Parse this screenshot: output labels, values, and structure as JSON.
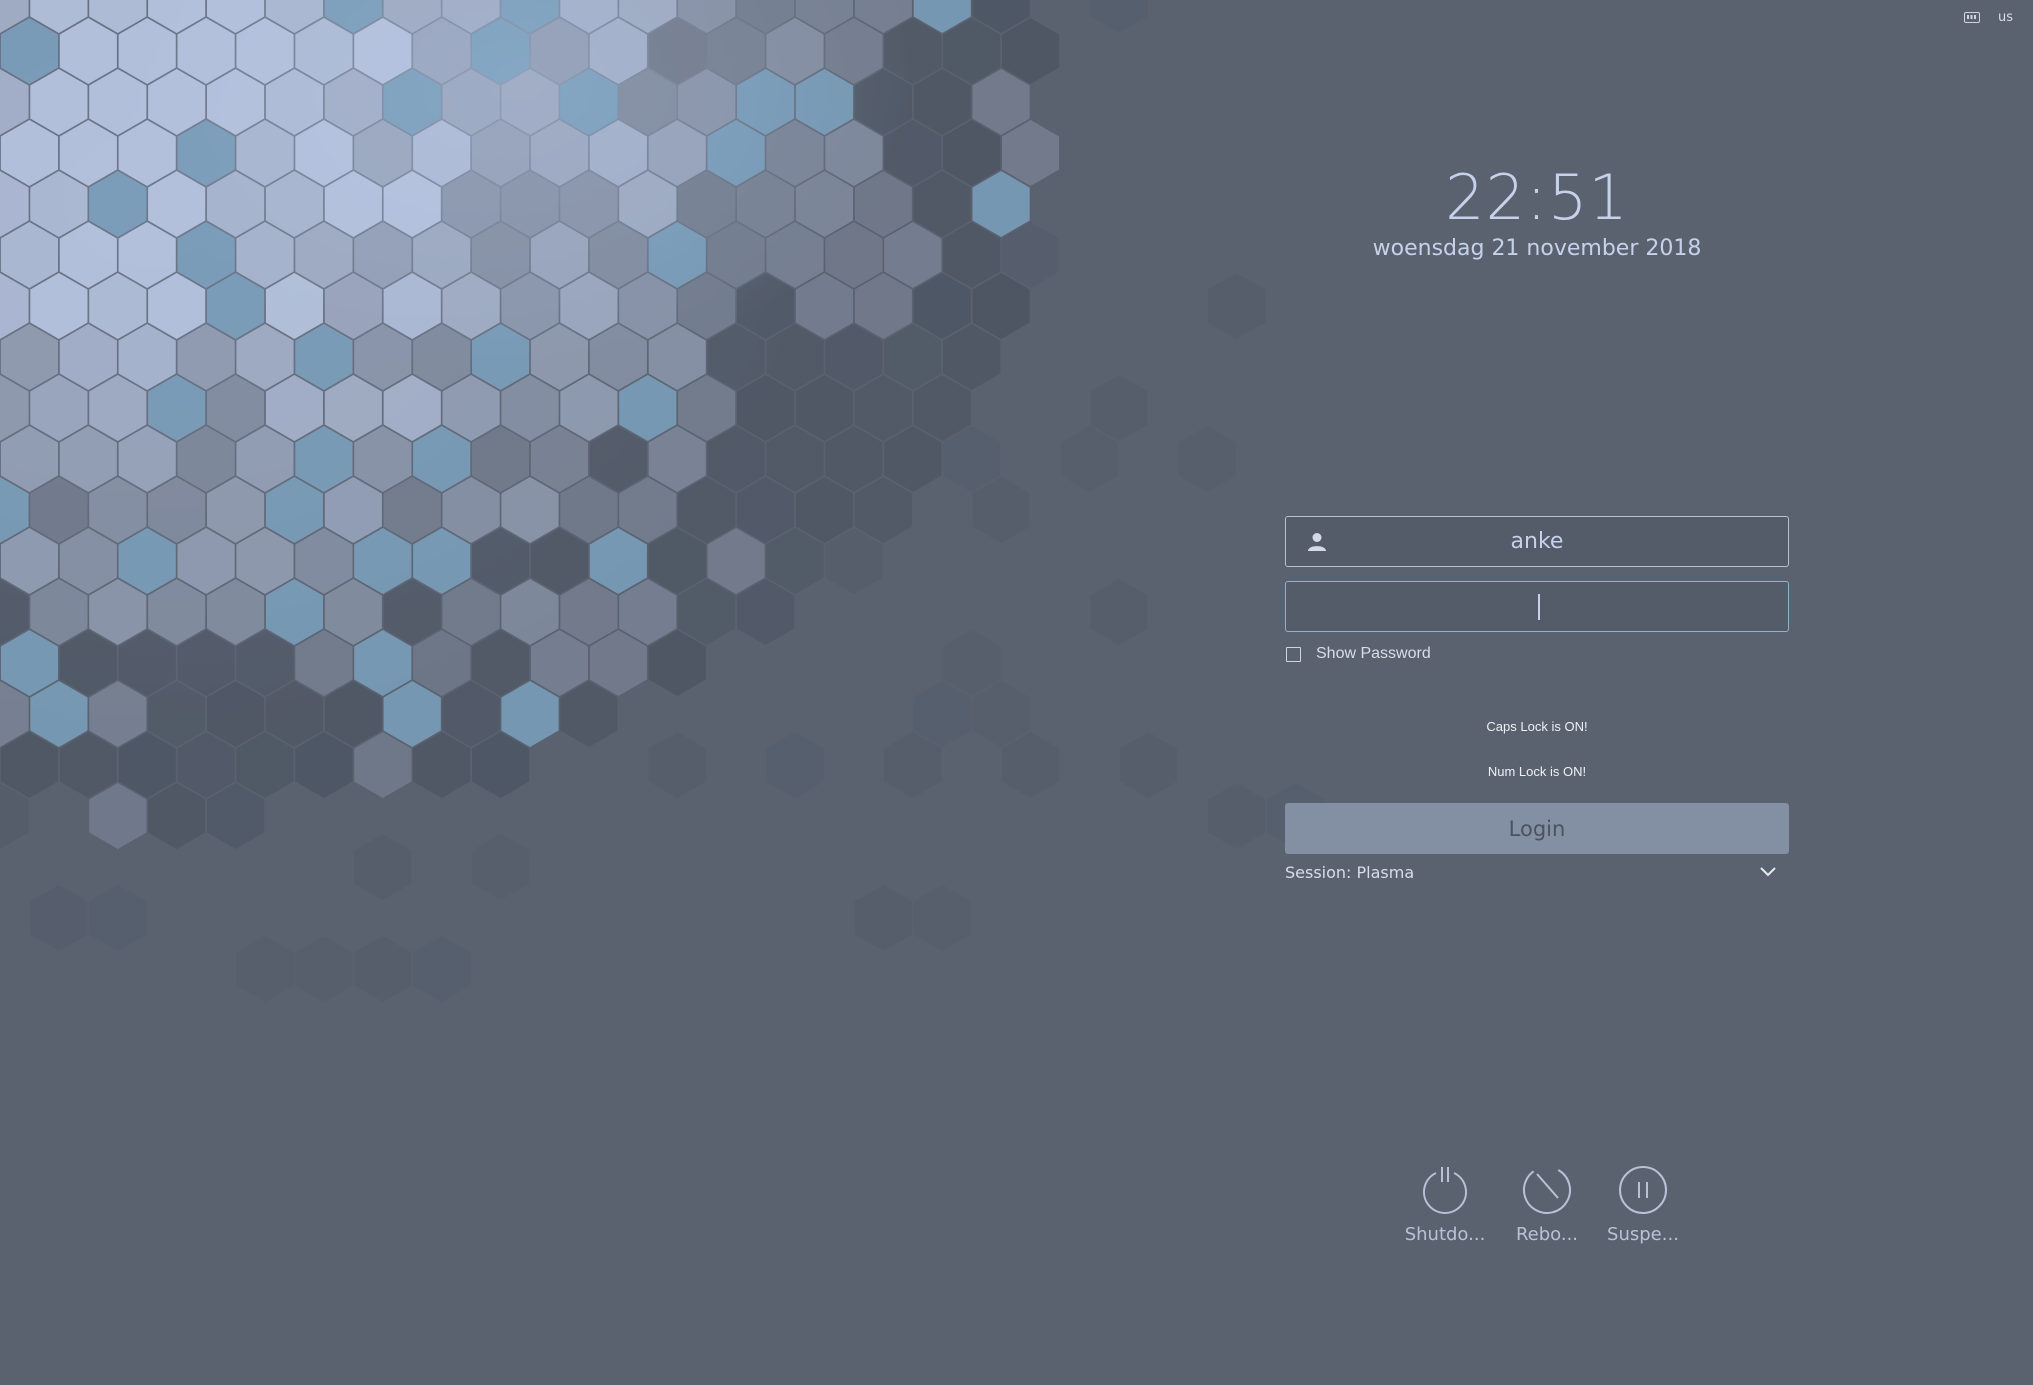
{
  "tray": {
    "keyboard_icon": "keyboard-icon",
    "layout": "us"
  },
  "clock": {
    "time": "22:51",
    "date": "woensdag 21 november 2018"
  },
  "login": {
    "username": "anke",
    "user_icon": "user-icon",
    "password_value": "",
    "show_password_label": "Show Password",
    "show_password_checked": false,
    "caps_lock_message": "Caps Lock is ON!",
    "num_lock_message": "Num Lock is ON!",
    "login_label": "Login",
    "session_label": "Session: Plasma"
  },
  "power": {
    "shutdown_label": "Shutdo...",
    "reboot_label": "Rebo...",
    "suspend_label": "Suspe..."
  },
  "colors": {
    "background": "#5a6270",
    "accent_text": "#c6d2ea",
    "login_button": "#838fa2",
    "focus_border": "#8fb2cc"
  }
}
